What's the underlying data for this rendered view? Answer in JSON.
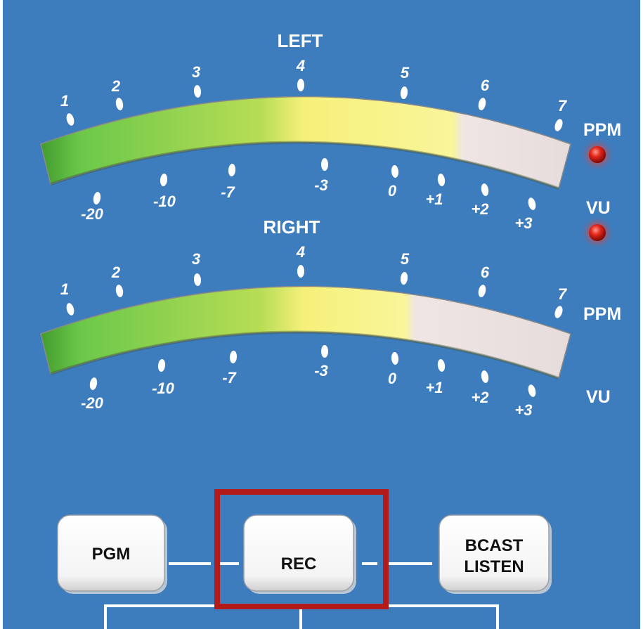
{
  "meters": [
    {
      "channel": "LEFT",
      "ppm_scale": [
        "1",
        "2",
        "3",
        "4",
        "5",
        "6",
        "7"
      ],
      "vu_scale": [
        "-20",
        "-10",
        "-7",
        "-3",
        "0",
        "+1",
        "+2",
        "+3"
      ],
      "mode_labels": {
        "ppm": "PPM",
        "vu": "VU"
      },
      "led_color": "#e1251b"
    },
    {
      "channel": "RIGHT",
      "ppm_scale": [
        "1",
        "2",
        "3",
        "4",
        "5",
        "6",
        "7"
      ],
      "vu_scale": [
        "-20",
        "-10",
        "-7",
        "-3",
        "0",
        "+1",
        "+2",
        "+3"
      ],
      "mode_labels": {
        "ppm": "PPM",
        "vu": "VU"
      }
    }
  ],
  "buttons": {
    "pgm": "PGM",
    "rec": "REC",
    "bcast_line1": "BCAST",
    "bcast_line2": "LISTEN",
    "highlighted": "REC"
  },
  "colors": {
    "panel_bg": "#3d7dbd",
    "meter_green": "#5cbf3a",
    "meter_yellow": "#f4ef7a",
    "meter_white": "#eeeaea",
    "highlight_border": "#b31a1a",
    "button_face": "#ffffff"
  }
}
